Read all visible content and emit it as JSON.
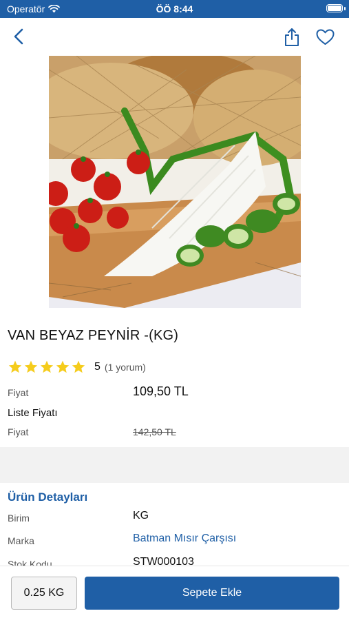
{
  "status_bar": {
    "carrier": "Operatör",
    "time": "ÖÖ 8:44"
  },
  "nav": {
    "back_icon": "chevron-left-icon",
    "share_icon": "share-icon",
    "favorite_icon": "heart-icon"
  },
  "product": {
    "title": "VAN BEYAZ PEYNİR -(KG)",
    "rating": {
      "stars": 5,
      "score": "5",
      "reviews": "(1 yorum)"
    },
    "price_label": "Fiyat",
    "price": "109,50 TL",
    "list_price_title": "Liste Fiyatı",
    "list_price_label": "Fiyat",
    "list_price": "142,50 TL"
  },
  "details": {
    "title": "Ürün Detayları",
    "rows": [
      {
        "label": "Birim",
        "value": "KG"
      },
      {
        "label": "Marka",
        "value": "Batman Mısır Çarşısı"
      },
      {
        "label": "Stok Kodu",
        "value": "STW000103"
      }
    ]
  },
  "bottom": {
    "quantity": "0.25 KG",
    "add_to_cart": "Sepete Ekle"
  },
  "colors": {
    "primary": "#1f5fa6",
    "star": "#f5cc1c",
    "separator": "#f2f2f2"
  }
}
